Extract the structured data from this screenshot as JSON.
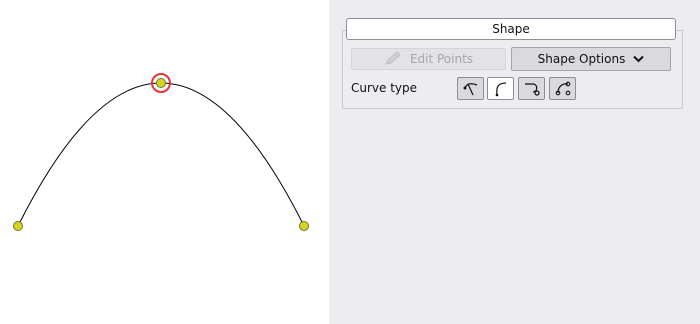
{
  "panel": {
    "title": "Shape",
    "edit_points_label": "Edit Points",
    "shape_options_label": "Shape Options",
    "curve_type_label": "Curve type",
    "curve_types": [
      {
        "icon": "curve-type-1-icon",
        "selected": false
      },
      {
        "icon": "curve-type-2-icon",
        "selected": true
      },
      {
        "icon": "curve-type-3-icon",
        "selected": false
      },
      {
        "icon": "curve-type-4-icon",
        "selected": false
      }
    ]
  },
  "canvas": {
    "curve_color": "#000000",
    "point_color": "#d4d426",
    "selection_color": "#e8333c"
  }
}
